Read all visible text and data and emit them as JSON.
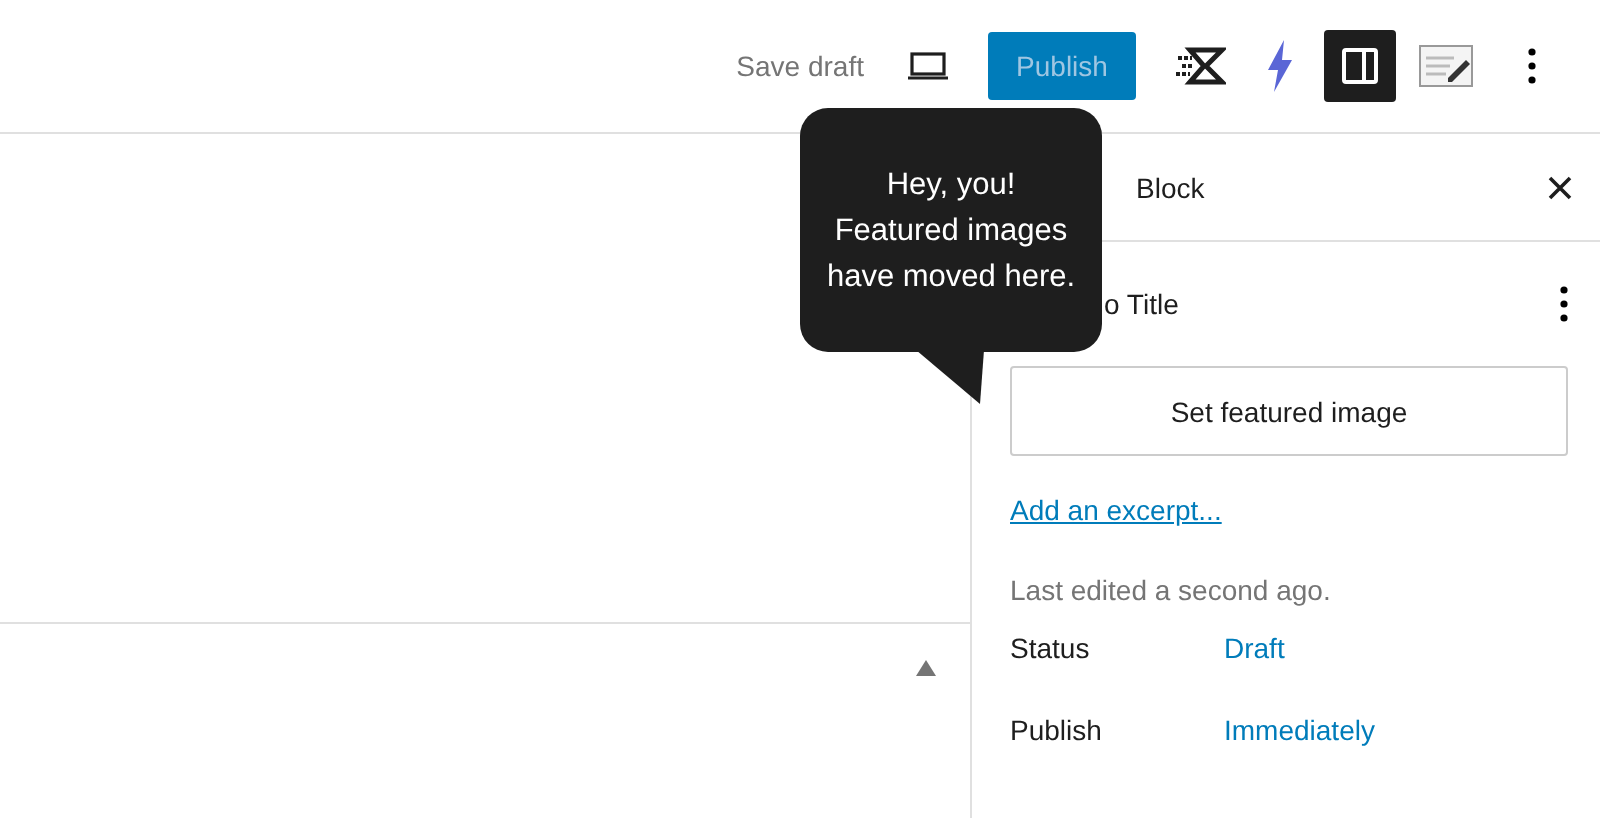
{
  "toolbar": {
    "save_draft": "Save draft",
    "publish": {
      "label": "Publish",
      "disabled": true
    },
    "settings_toggle": {
      "pressed": true
    }
  },
  "tooltip": {
    "lines": [
      "Hey, you!",
      "Featured images",
      "have moved here."
    ]
  },
  "sidebar": {
    "tabs": [
      {
        "label": "Block"
      }
    ],
    "post_title": "o Title",
    "featured_image_button": "Set featured image",
    "excerpt_link": "Add an excerpt...",
    "last_edited": "Last edited a second ago.",
    "rows": [
      {
        "label": "Status",
        "value": "Draft"
      },
      {
        "label": "Publish",
        "value": "Immediately"
      }
    ]
  }
}
